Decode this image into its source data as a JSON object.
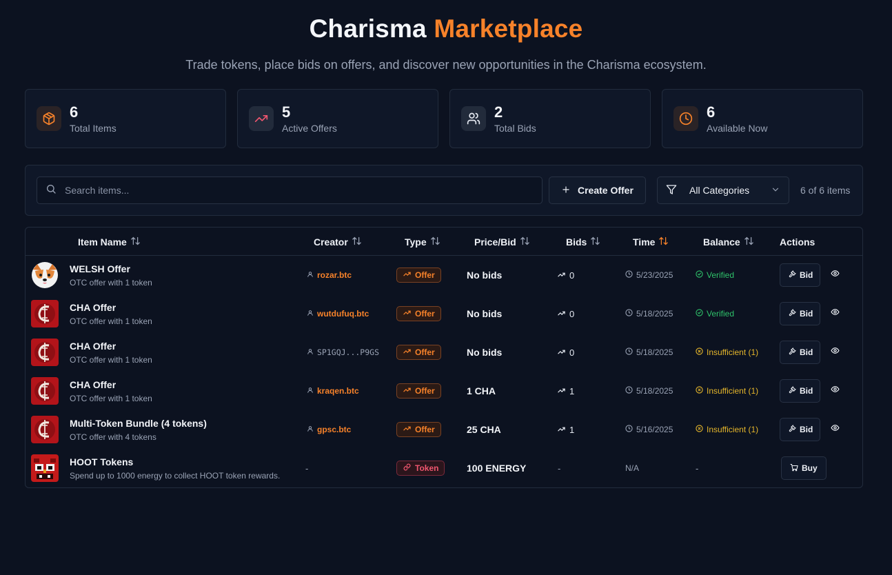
{
  "header": {
    "title_part1": "Charisma",
    "title_part2": "Marketplace",
    "subtitle": "Trade tokens, place bids on offers, and discover new opportunities in the Charisma ecosystem."
  },
  "stats": [
    {
      "value": "6",
      "label": "Total Items",
      "icon": "package-icon"
    },
    {
      "value": "5",
      "label": "Active Offers",
      "icon": "trending-up-icon"
    },
    {
      "value": "2",
      "label": "Total Bids",
      "icon": "users-icon"
    },
    {
      "value": "6",
      "label": "Available Now",
      "icon": "clock-icon"
    }
  ],
  "toolbar": {
    "search_placeholder": "Search items...",
    "create_label": "Create Offer",
    "category_value": "All Categories",
    "count_text": "6 of 6 items"
  },
  "columns": {
    "item_name": "Item Name",
    "creator": "Creator",
    "type": "Type",
    "price": "Price/Bid",
    "bids": "Bids",
    "time": "Time",
    "balance": "Balance",
    "actions": "Actions"
  },
  "rows": [
    {
      "name": "WELSH Offer",
      "desc": "OTC offer with 1 token",
      "thumb": "welsh-corgi",
      "creator": "rozar.btc",
      "type": "Offer",
      "price": "No bids",
      "bids": "0",
      "time": "5/23/2025",
      "balance": "Verified",
      "balance_status": "verified",
      "action": "Bid"
    },
    {
      "name": "CHA Offer",
      "desc": "OTC offer with 1 token",
      "thumb": "cha-logo",
      "creator": "wutdufuq.btc",
      "type": "Offer",
      "price": "No bids",
      "bids": "0",
      "time": "5/18/2025",
      "balance": "Verified",
      "balance_status": "verified",
      "action": "Bid"
    },
    {
      "name": "CHA Offer",
      "desc": "OTC offer with 1 token",
      "thumb": "cha-logo",
      "creator": "SP1GQJ...P9GS",
      "type": "Offer",
      "price": "No bids",
      "bids": "0",
      "time": "5/18/2025",
      "balance": "Insufficient (1)",
      "balance_status": "insufficient",
      "action": "Bid"
    },
    {
      "name": "CHA Offer",
      "desc": "OTC offer with 1 token",
      "thumb": "cha-logo",
      "creator": "kraqen.btc",
      "type": "Offer",
      "price": "1 CHA",
      "bids": "1",
      "time": "5/18/2025",
      "balance": "Insufficient (1)",
      "balance_status": "insufficient",
      "action": "Bid"
    },
    {
      "name": "Multi-Token Bundle (4 tokens)",
      "desc": "OTC offer with 4 tokens",
      "thumb": "cha-logo",
      "creator": "gpsc.btc",
      "type": "Offer",
      "price": "25 CHA",
      "bids": "1",
      "time": "5/16/2025",
      "balance": "Insufficient (1)",
      "balance_status": "insufficient",
      "action": "Bid"
    },
    {
      "name": "HOOT Tokens",
      "desc": "Spend up to 1000 energy to collect HOOT token rewards.",
      "thumb": "hoot-owl",
      "creator": "-",
      "type": "Token",
      "price": "100 ENERGY",
      "bids": "-",
      "time": "N/A",
      "balance": "-",
      "balance_status": "none",
      "action": "Buy"
    }
  ],
  "colors": {
    "accent": "#f7822a",
    "background": "#0c1220",
    "verified": "#2fc26a",
    "insufficient": "#e5b62b",
    "token_badge": "#f0566f"
  }
}
